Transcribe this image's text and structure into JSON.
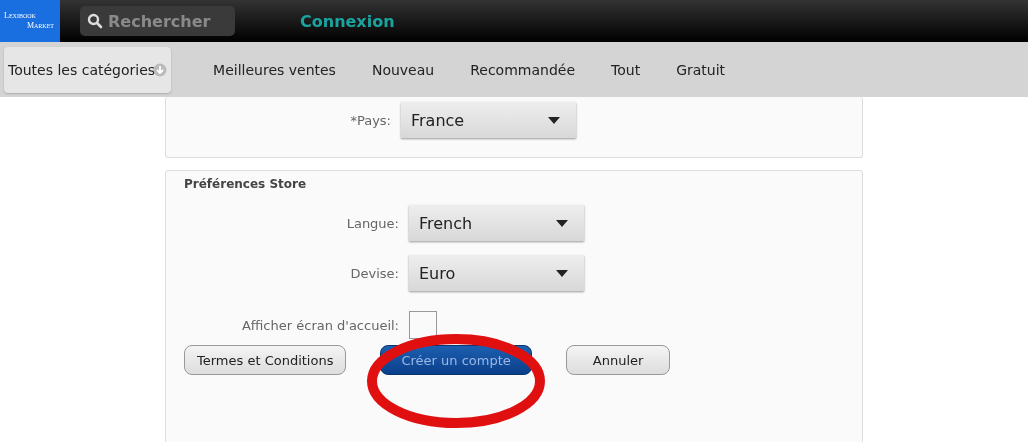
{
  "top_bar": {
    "logo": [
      "Lexibook",
      "Market"
    ],
    "search": {
      "placeholder": "Rechercher"
    },
    "login": "Connexion"
  },
  "categories": [
    {
      "label": "Toutes les catégories",
      "selected": true,
      "dropdown": true
    },
    {
      "label": "Meilleures ventes",
      "selected": false
    },
    {
      "label": "Nouveau",
      "selected": false
    },
    {
      "label": "Recommandée",
      "selected": false
    },
    {
      "label": "Tout",
      "selected": false
    },
    {
      "label": "Gratuit",
      "selected": false
    }
  ],
  "country": {
    "label": "*Pays:",
    "value": "France"
  },
  "store_preferences": {
    "title": "Préférences Store",
    "selects": [
      {
        "label": "Langue:",
        "value": "French"
      },
      {
        "label": "Devise:",
        "value": "Euro"
      }
    ],
    "home_screen": {
      "label": "Afficher écran d'accueil:",
      "checked": false
    },
    "buttons": [
      {
        "label": "Termes et Conditions",
        "kind": "secondary",
        "highlighted": false
      },
      {
        "label": "Créer un compte",
        "kind": "primary",
        "highlighted": true
      },
      {
        "label": "Annuler",
        "kind": "secondary",
        "highlighted": false
      }
    ]
  }
}
